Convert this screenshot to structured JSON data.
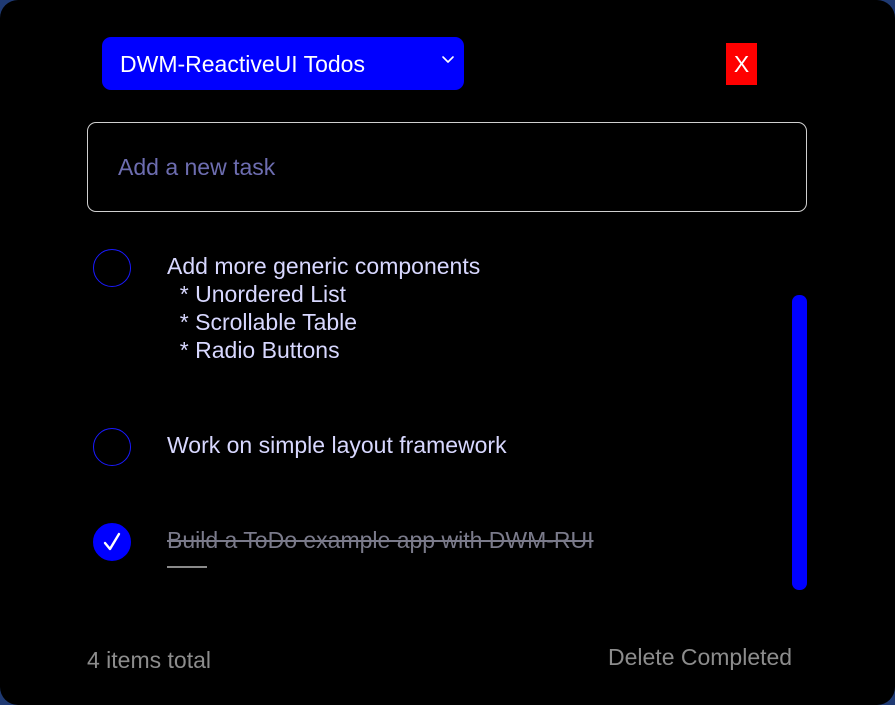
{
  "header": {
    "list_title": "DWM-ReactiveUI Todos",
    "close_label": "X"
  },
  "input": {
    "placeholder": "Add a new task",
    "value": ""
  },
  "todos": [
    {
      "text": "Add more generic components\n  * Unordered List\n  * Scrollable Table\n  * Radio Buttons",
      "completed": false
    },
    {
      "text": "Work on simple layout framework",
      "completed": false
    },
    {
      "text": "Build a ToDo example app with DWM-RUI",
      "completed": true
    }
  ],
  "footer": {
    "count_text": "4 items total",
    "delete_completed_label": "Delete Completed"
  },
  "icons": {
    "select": "chevron-down-icon",
    "check": "checkmark-icon"
  },
  "colors": {
    "background": "#000000",
    "accent": "#0000ff",
    "close": "#ff0000",
    "text": "#d8d8ff",
    "muted": "#8c8c8c"
  }
}
